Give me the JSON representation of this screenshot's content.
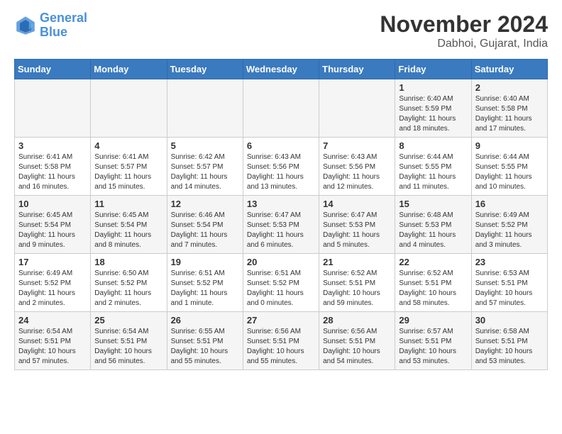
{
  "logo": {
    "line1": "General",
    "line2": "Blue"
  },
  "title": "November 2024",
  "location": "Dabhoi, Gujarat, India",
  "weekdays": [
    "Sunday",
    "Monday",
    "Tuesday",
    "Wednesday",
    "Thursday",
    "Friday",
    "Saturday"
  ],
  "weeks": [
    [
      {
        "day": "",
        "info": ""
      },
      {
        "day": "",
        "info": ""
      },
      {
        "day": "",
        "info": ""
      },
      {
        "day": "",
        "info": ""
      },
      {
        "day": "",
        "info": ""
      },
      {
        "day": "1",
        "info": "Sunrise: 6:40 AM\nSunset: 5:59 PM\nDaylight: 11 hours\nand 18 minutes."
      },
      {
        "day": "2",
        "info": "Sunrise: 6:40 AM\nSunset: 5:58 PM\nDaylight: 11 hours\nand 17 minutes."
      }
    ],
    [
      {
        "day": "3",
        "info": "Sunrise: 6:41 AM\nSunset: 5:58 PM\nDaylight: 11 hours\nand 16 minutes."
      },
      {
        "day": "4",
        "info": "Sunrise: 6:41 AM\nSunset: 5:57 PM\nDaylight: 11 hours\nand 15 minutes."
      },
      {
        "day": "5",
        "info": "Sunrise: 6:42 AM\nSunset: 5:57 PM\nDaylight: 11 hours\nand 14 minutes."
      },
      {
        "day": "6",
        "info": "Sunrise: 6:43 AM\nSunset: 5:56 PM\nDaylight: 11 hours\nand 13 minutes."
      },
      {
        "day": "7",
        "info": "Sunrise: 6:43 AM\nSunset: 5:56 PM\nDaylight: 11 hours\nand 12 minutes."
      },
      {
        "day": "8",
        "info": "Sunrise: 6:44 AM\nSunset: 5:55 PM\nDaylight: 11 hours\nand 11 minutes."
      },
      {
        "day": "9",
        "info": "Sunrise: 6:44 AM\nSunset: 5:55 PM\nDaylight: 11 hours\nand 10 minutes."
      }
    ],
    [
      {
        "day": "10",
        "info": "Sunrise: 6:45 AM\nSunset: 5:54 PM\nDaylight: 11 hours\nand 9 minutes."
      },
      {
        "day": "11",
        "info": "Sunrise: 6:45 AM\nSunset: 5:54 PM\nDaylight: 11 hours\nand 8 minutes."
      },
      {
        "day": "12",
        "info": "Sunrise: 6:46 AM\nSunset: 5:54 PM\nDaylight: 11 hours\nand 7 minutes."
      },
      {
        "day": "13",
        "info": "Sunrise: 6:47 AM\nSunset: 5:53 PM\nDaylight: 11 hours\nand 6 minutes."
      },
      {
        "day": "14",
        "info": "Sunrise: 6:47 AM\nSunset: 5:53 PM\nDaylight: 11 hours\nand 5 minutes."
      },
      {
        "day": "15",
        "info": "Sunrise: 6:48 AM\nSunset: 5:53 PM\nDaylight: 11 hours\nand 4 minutes."
      },
      {
        "day": "16",
        "info": "Sunrise: 6:49 AM\nSunset: 5:52 PM\nDaylight: 11 hours\nand 3 minutes."
      }
    ],
    [
      {
        "day": "17",
        "info": "Sunrise: 6:49 AM\nSunset: 5:52 PM\nDaylight: 11 hours\nand 2 minutes."
      },
      {
        "day": "18",
        "info": "Sunrise: 6:50 AM\nSunset: 5:52 PM\nDaylight: 11 hours\nand 2 minutes."
      },
      {
        "day": "19",
        "info": "Sunrise: 6:51 AM\nSunset: 5:52 PM\nDaylight: 11 hours\nand 1 minute."
      },
      {
        "day": "20",
        "info": "Sunrise: 6:51 AM\nSunset: 5:52 PM\nDaylight: 11 hours\nand 0 minutes."
      },
      {
        "day": "21",
        "info": "Sunrise: 6:52 AM\nSunset: 5:51 PM\nDaylight: 10 hours\nand 59 minutes."
      },
      {
        "day": "22",
        "info": "Sunrise: 6:52 AM\nSunset: 5:51 PM\nDaylight: 10 hours\nand 58 minutes."
      },
      {
        "day": "23",
        "info": "Sunrise: 6:53 AM\nSunset: 5:51 PM\nDaylight: 10 hours\nand 57 minutes."
      }
    ],
    [
      {
        "day": "24",
        "info": "Sunrise: 6:54 AM\nSunset: 5:51 PM\nDaylight: 10 hours\nand 57 minutes."
      },
      {
        "day": "25",
        "info": "Sunrise: 6:54 AM\nSunset: 5:51 PM\nDaylight: 10 hours\nand 56 minutes."
      },
      {
        "day": "26",
        "info": "Sunrise: 6:55 AM\nSunset: 5:51 PM\nDaylight: 10 hours\nand 55 minutes."
      },
      {
        "day": "27",
        "info": "Sunrise: 6:56 AM\nSunset: 5:51 PM\nDaylight: 10 hours\nand 55 minutes."
      },
      {
        "day": "28",
        "info": "Sunrise: 6:56 AM\nSunset: 5:51 PM\nDaylight: 10 hours\nand 54 minutes."
      },
      {
        "day": "29",
        "info": "Sunrise: 6:57 AM\nSunset: 5:51 PM\nDaylight: 10 hours\nand 53 minutes."
      },
      {
        "day": "30",
        "info": "Sunrise: 6:58 AM\nSunset: 5:51 PM\nDaylight: 10 hours\nand 53 minutes."
      }
    ]
  ]
}
